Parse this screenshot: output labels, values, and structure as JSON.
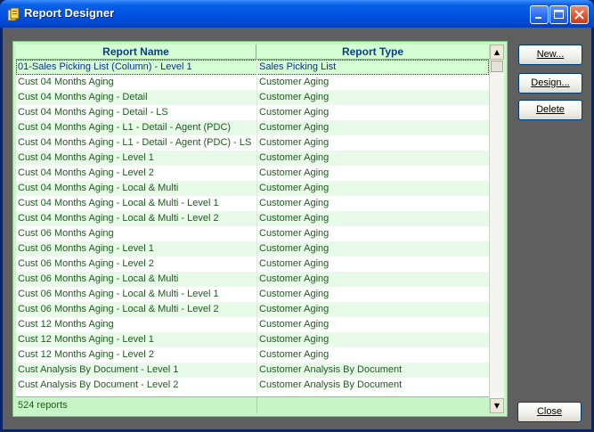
{
  "window": {
    "title": "Report Designer"
  },
  "colors": {
    "accent": "#0054e3",
    "grid_text": "#1f5a1f",
    "grid_header": "#0b3f7a",
    "grid_bg": "#c8f5c8"
  },
  "grid": {
    "columns": [
      "Report Name",
      "Report Type"
    ],
    "rows": [
      [
        "01-Sales Picking List (Column) - Level 1",
        "Sales Picking List"
      ],
      [
        "Cust 04 Months Aging",
        "Customer Aging"
      ],
      [
        "Cust 04 Months Aging - Detail",
        "Customer Aging"
      ],
      [
        "Cust 04 Months Aging - Detail - LS",
        "Customer Aging"
      ],
      [
        "Cust 04 Months Aging - L1 - Detail - Agent (PDC)",
        "Customer Aging"
      ],
      [
        "Cust 04 Months Aging - L1 - Detail - Agent (PDC) - LS",
        "Customer Aging"
      ],
      [
        "Cust 04 Months Aging - Level 1",
        "Customer Aging"
      ],
      [
        "Cust 04 Months Aging - Level 2",
        "Customer Aging"
      ],
      [
        "Cust 04 Months Aging - Local & Multi",
        "Customer Aging"
      ],
      [
        "Cust 04 Months Aging - Local & Multi - Level 1",
        "Customer Aging"
      ],
      [
        "Cust 04 Months Aging - Local & Multi - Level 2",
        "Customer Aging"
      ],
      [
        "Cust 06 Months Aging",
        "Customer Aging"
      ],
      [
        "Cust 06 Months Aging - Level 1",
        "Customer Aging"
      ],
      [
        "Cust 06 Months Aging - Level 2",
        "Customer Aging"
      ],
      [
        "Cust 06 Months Aging - Local & Multi",
        "Customer Aging"
      ],
      [
        "Cust 06 Months Aging - Local & Multi - Level 1",
        "Customer Aging"
      ],
      [
        "Cust 06 Months Aging - Local & Multi - Level 2",
        "Customer Aging"
      ],
      [
        "Cust 12 Months Aging",
        "Customer Aging"
      ],
      [
        "Cust 12 Months Aging - Level 1",
        "Customer Aging"
      ],
      [
        "Cust 12 Months Aging - Level 2",
        "Customer Aging"
      ],
      [
        "Cust Analysis By Document - Level 1",
        "Customer Analysis By Document"
      ],
      [
        "Cust Analysis By Document - Level 2",
        "Customer Analysis By Document"
      ]
    ],
    "footer": "524 reports"
  },
  "buttons": {
    "new": "New...",
    "design": "Design...",
    "delete": "Delete",
    "close": "Close"
  },
  "icons": {
    "app": "report-designer-icon",
    "minimize": "minimize-icon",
    "maximize": "maximize-icon",
    "close": "close-icon"
  }
}
